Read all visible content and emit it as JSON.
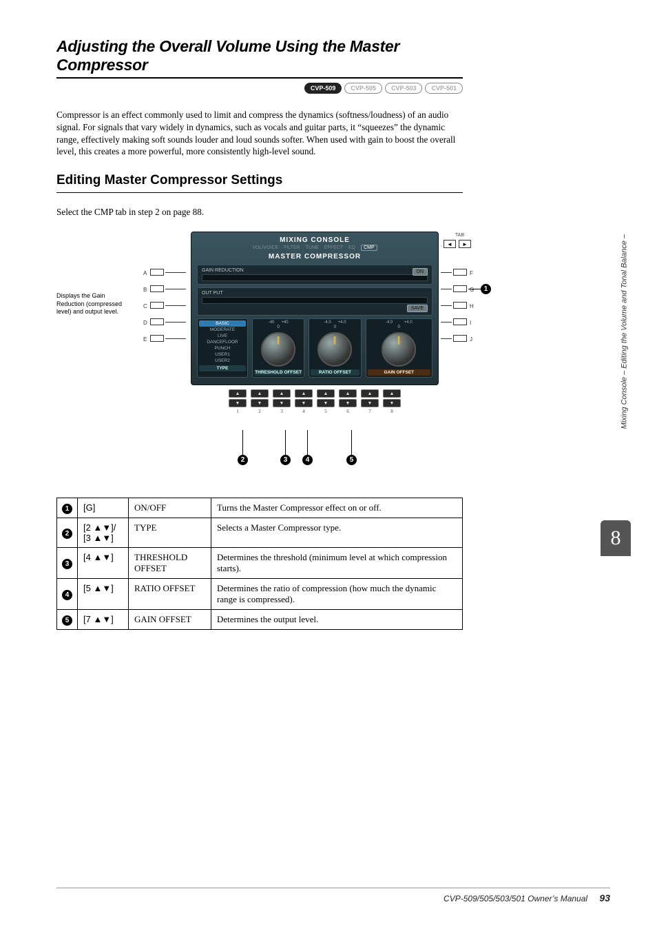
{
  "section_title": "Adjusting the Overall Volume Using the Master Compressor",
  "badges": [
    "CVP-509",
    "CVP-505",
    "CVP-503",
    "CVP-501"
  ],
  "badge_active_index": 0,
  "intro": "Compressor is an effect commonly used to limit and compress the dynamics (softness/loudness) of an audio signal. For signals that vary widely in dynamics, such as vocals and guitar parts, it “squeezes” the dynamic range, effectively making soft sounds louder and loud sounds softer. When used with gain to boost the overall level, this creates a more powerful, more consistently high-level sound.",
  "subheading": "Editing Master Compressor Settings",
  "lead": "Select the CMP tab in step 2 on page 88.",
  "side_note": "Displays the Gain Reduction (compressed level) and output level.",
  "screenshot": {
    "console_title": "MIXING CONSOLE",
    "tabs": [
      "VOL/VOICE",
      "FILTER",
      "TUNE",
      "EFFECT",
      "EQ",
      "CMP"
    ],
    "tabs_current": "CMP",
    "tab_label": "TAB",
    "mc_title": "MASTER COMPRESSOR",
    "gain_red_label": "GAIN REDUCTION",
    "output_label": "OUT PUT",
    "on_label": "ON",
    "save_label": "SAVE",
    "type_header": "TYPE",
    "type_options": [
      "BASIC",
      "MODERATE",
      "LIVE",
      "DANCEFLOOR",
      "PUNCH",
      "USER1",
      "USER2"
    ],
    "type_selected": "BASIC",
    "thresh_header": "THRESHOLD OFFSET",
    "ratio_header": "RATIO OFFSET",
    "gain_header": "GAIN OFFSET",
    "left_labels": [
      "A",
      "B",
      "C",
      "D",
      "E"
    ],
    "right_labels": [
      "F",
      "G",
      "H",
      "I",
      "J"
    ],
    "bottom_numbers": [
      "1",
      "2",
      "3",
      "4",
      "5",
      "6",
      "7",
      "8"
    ]
  },
  "callouts": [
    "1",
    "2",
    "3",
    "4",
    "5"
  ],
  "table": [
    {
      "num": "1",
      "btn": "[G]",
      "param": "ON/OFF",
      "desc": "Turns the Master Compressor effect on or off."
    },
    {
      "num": "2",
      "btn": "[2 ▲▼]/ [3 ▲▼]",
      "param": "TYPE",
      "desc": "Selects a Master Compressor type."
    },
    {
      "num": "3",
      "btn": "[4 ▲▼]",
      "param": "THRESHOLD OFFSET",
      "desc": "Determines the threshold (minimum level at which compression starts)."
    },
    {
      "num": "4",
      "btn": "[5 ▲▼]",
      "param": "RATIO OFFSET",
      "desc": "Determines the ratio of compression (how much the dynamic range is compressed)."
    },
    {
      "num": "5",
      "btn": "[7 ▲▼]",
      "param": "GAIN OFFSET",
      "desc": "Determines the output level."
    }
  ],
  "side_chapter": "8",
  "side_label": "Mixing Console – Editing the Volume and Tonal Balance –",
  "footer_text": "CVP-509/505/503/501 Owner’s Manual",
  "page_number": "93"
}
